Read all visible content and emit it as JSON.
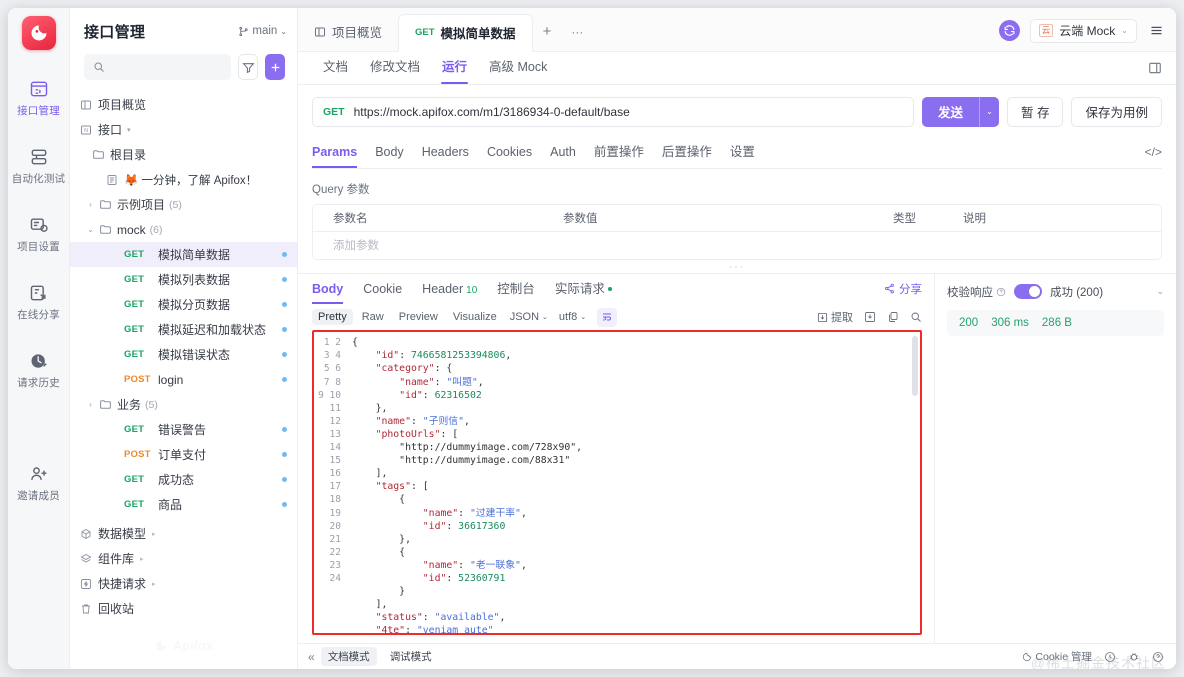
{
  "rail": {
    "logo_icon": "apifox-logo-icon",
    "items": [
      {
        "label": "接口管理",
        "icon": "api-management-icon",
        "active": true
      },
      {
        "label": "自动化测试",
        "icon": "automation-test-icon",
        "active": false
      },
      {
        "label": "项目设置",
        "icon": "project-settings-icon",
        "active": false
      },
      {
        "label": "在线分享",
        "icon": "online-share-icon",
        "active": false
      },
      {
        "label": "请求历史",
        "icon": "request-history-icon",
        "active": false
      },
      {
        "label": "邀请成员",
        "icon": "invite-member-icon",
        "active": false
      }
    ]
  },
  "sidebar": {
    "title": "接口管理",
    "branch": "main",
    "search_placeholder": "",
    "filter_icon": "filter-icon",
    "add_icon": "plus-icon",
    "watermark": "Apifox",
    "tree": [
      {
        "indent": 1,
        "icon": "overview-icon",
        "label": "项目概览",
        "type": "node"
      },
      {
        "indent": 1,
        "icon": "api-icon",
        "label": "接口",
        "type": "node",
        "trailing_caret": true
      },
      {
        "indent": 2,
        "icon": "folder-icon",
        "label": "根目录",
        "type": "folder"
      },
      {
        "indent": 3,
        "icon": "doc-icon",
        "label": "🦊 一分钟，了解 Apifox！",
        "type": "doc"
      },
      {
        "indent": 2,
        "caret": "›",
        "icon": "folder-icon",
        "label": "示例项目",
        "count": "(5)",
        "type": "folder"
      },
      {
        "indent": 2,
        "caret": "⌄",
        "icon": "folder-icon",
        "label": "mock",
        "count": "(6)",
        "type": "folder"
      },
      {
        "indent": 3,
        "method": "GET",
        "label": "模拟简单数据",
        "type": "api",
        "selected": true
      },
      {
        "indent": 3,
        "method": "GET",
        "label": "模拟列表数据",
        "type": "api"
      },
      {
        "indent": 3,
        "method": "GET",
        "label": "模拟分页数据",
        "type": "api"
      },
      {
        "indent": 3,
        "method": "GET",
        "label": "模拟延迟和加载状态",
        "type": "api"
      },
      {
        "indent": 3,
        "method": "GET",
        "label": "模拟错误状态",
        "type": "api"
      },
      {
        "indent": 3,
        "method": "POST",
        "label": "login",
        "type": "api"
      },
      {
        "indent": 2,
        "caret": "›",
        "icon": "folder-icon",
        "label": "业务",
        "count": "(5)",
        "type": "folder"
      },
      {
        "indent": 3,
        "method": "GET",
        "label": "错误警告",
        "type": "api"
      },
      {
        "indent": 3,
        "method": "POST",
        "label": "订单支付",
        "type": "api"
      },
      {
        "indent": 3,
        "method": "GET",
        "label": "成功态",
        "type": "api"
      },
      {
        "indent": 3,
        "method": "GET",
        "label": "商品",
        "type": "api"
      },
      {
        "indent": 1,
        "icon": "data-model-icon",
        "label": "数据模型",
        "type": "node",
        "trailing_caret": true
      },
      {
        "indent": 1,
        "icon": "component-lib-icon",
        "label": "组件库",
        "type": "node",
        "trailing_caret": true
      },
      {
        "indent": 1,
        "icon": "quick-request-icon",
        "label": "快捷请求",
        "type": "node",
        "trailing_caret": true
      },
      {
        "indent": 1,
        "icon": "trash-icon",
        "label": "回收站",
        "type": "node"
      }
    ]
  },
  "topbar": {
    "tabs": [
      {
        "label": "项目概览",
        "icon": "overview-icon",
        "method": "",
        "active": false
      },
      {
        "label": "模拟简单数据",
        "icon": "",
        "method": "GET",
        "active": true
      }
    ],
    "add_tab_label": "+",
    "more_tabs_label": "···",
    "sync_icon": "sync-icon",
    "mock_badge": "云",
    "mock_label": "云端 Mock",
    "menu_icon": "hamburger-icon"
  },
  "subtabs": {
    "items": [
      "文档",
      "修改文档",
      "运行",
      "高级 Mock"
    ],
    "active": "运行",
    "right_icon": "panel-layout-icon"
  },
  "request": {
    "method": "GET",
    "url": "https://mock.apifox.com/m1/3186934-0-default/base",
    "send_label": "发送",
    "send_caret": "⌄",
    "save_draft_label": "暂 存",
    "save_as_case_label": "保存为用例",
    "tabs": [
      "Params",
      "Body",
      "Headers",
      "Cookies",
      "Auth",
      "前置操作",
      "后置操作",
      "设置"
    ],
    "active_tab": "Params",
    "code_icon": "code-brackets-icon",
    "query_title": "Query 参数",
    "table_headers": [
      "参数名",
      "参数值",
      "类型",
      "说明"
    ],
    "empty_row_placeholder": "添加参数"
  },
  "response": {
    "tabs": [
      {
        "label": "Body",
        "badge": "",
        "active": true
      },
      {
        "label": "Cookie",
        "badge": "",
        "active": false
      },
      {
        "label": "Header",
        "badge": "10",
        "active": false
      },
      {
        "label": "控制台",
        "badge": "",
        "active": false
      },
      {
        "label": "实际请求",
        "badge": "dot",
        "active": false
      }
    ],
    "share_label": "分享",
    "share_icon": "share-icon",
    "formats": [
      "Pretty",
      "Raw",
      "Preview",
      "Visualize"
    ],
    "active_format": "Pretty",
    "lang_select": "JSON",
    "encoding_select": "utf8",
    "wrap_icon": "wrap-lines-icon",
    "extract_label": "提取",
    "extract_icon": "extract-icon",
    "save_icon": "save-icon",
    "copy_icon": "copy-icon",
    "search_icon": "search-icon",
    "expand_icon": "expand-icon",
    "code_lines": [
      "{",
      "    \"id\": 7466581253394806,",
      "    \"category\": {",
      "        \"name\": \"叫题\",",
      "        \"id\": 62316502",
      "    },",
      "    \"name\": \"子则信\",",
      "    \"photoUrls\": [",
      "        \"http://dummyimage.com/728x90\",",
      "        \"http://dummyimage.com/88x31\"",
      "    ],",
      "    \"tags\": [",
      "        {",
      "            \"name\": \"过建干率\",",
      "            \"id\": 36617360",
      "        },",
      "        {",
      "            \"name\": \"老一联象\",",
      "            \"id\": 52360791",
      "        }",
      "    ],",
      "    \"status\": \"available\",",
      "    \"4te\": \"veniam aute\"",
      "}"
    ],
    "line_count": 24,
    "verify_label": "校验响应",
    "verify_help_icon": "help-icon",
    "verify_on": true,
    "status_text": "成功 (200)",
    "stat_status": "200",
    "stat_time": "306 ms",
    "stat_size": "286 B"
  },
  "bottombar": {
    "collapse_icon": "collapse-left-icon",
    "modes": [
      "文档模式",
      "调试模式"
    ],
    "active_mode": "文档模式",
    "cookie_label": "Cookie 管理",
    "cookie_icon": "cookie-icon",
    "help_icon": "help-circle-icon",
    "bug_icon": "bug-icon",
    "question_icon": "question-circle-icon",
    "watermark": "@稀土掘金技术社区"
  },
  "colors": {
    "accent": "#7c5cf0",
    "primary_button": "#8b6ef0",
    "get_method": "#1aa463",
    "post_method": "#f08a24",
    "error_border": "#ee2b2b",
    "logo_red": "#e8243b"
  }
}
